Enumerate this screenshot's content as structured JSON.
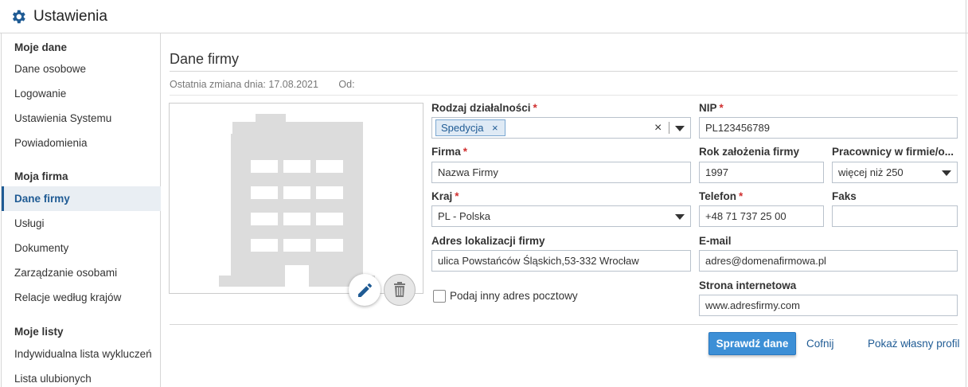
{
  "header": {
    "title": "Ustawienia"
  },
  "sidebar": {
    "groups": [
      {
        "heading": "Moje dane",
        "items": [
          "Dane osobowe",
          "Logowanie",
          "Ustawienia Systemu",
          "Powiadomienia"
        ]
      },
      {
        "heading": "Moja firma",
        "items": [
          "Dane firmy",
          "Usługi",
          "Dokumenty",
          "Zarządzanie osobami",
          "Relacje według krajów"
        ]
      },
      {
        "heading": "Moje listy",
        "items": [
          "Indywidualna lista wykluczeń",
          "Lista ulubionych"
        ]
      }
    ],
    "active_item": "Dane firmy"
  },
  "main": {
    "title": "Dane firmy",
    "last_change_label": "Ostatnia zmiana dnia: 17.08.2021",
    "od_label": "Od:",
    "form": {
      "activity": {
        "label": "Rodzaj działalności",
        "required": "*",
        "tag": "Spedycja",
        "tag_remove": "×",
        "clear": "×"
      },
      "nip": {
        "label": "NIP",
        "required": "*",
        "value": "PL123456789"
      },
      "firma": {
        "label": "Firma",
        "required": "*",
        "value": "Nazwa Firmy"
      },
      "year": {
        "label": "Rok założenia firmy",
        "value": "1997"
      },
      "employees": {
        "label": "Pracownicy w firmie/o...",
        "value": "więcej niż 250"
      },
      "country": {
        "label": "Kraj",
        "required": "*",
        "value": "PL - Polska"
      },
      "phone": {
        "label": "Telefon",
        "required": "*",
        "value": "+48 71 737 25 00"
      },
      "fax": {
        "label": "Faks",
        "value": ""
      },
      "address": {
        "label": "Adres lokalizacji firmy",
        "value": "ulica Powstańców Śląskich,53-332 Wrocław"
      },
      "email": {
        "label": "E-mail",
        "value": "adres@domenafirmowa.pl"
      },
      "website": {
        "label": "Strona internetowa",
        "value": "www.adresfirmy.com"
      },
      "other_address": {
        "label": "Podaj inny adres pocztowy",
        "checked": false
      }
    },
    "actions": {
      "check": "Sprawdź dane",
      "undo": "Cofnij",
      "profile": "Pokaż własny profil"
    }
  },
  "colors": {
    "accent": "#1f5b94",
    "primary_button": "#3c8fd6",
    "required": "#d03030"
  },
  "icons": {
    "header": "gear-icon",
    "edit": "pencil-icon",
    "delete": "trash-icon",
    "placeholder": "building-icon"
  }
}
